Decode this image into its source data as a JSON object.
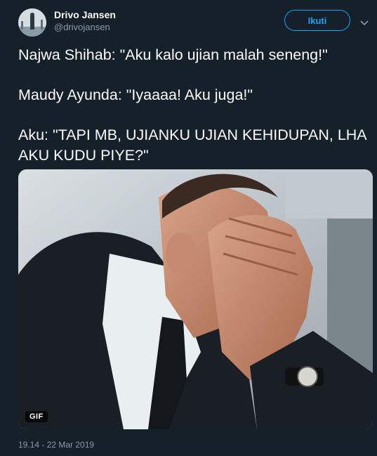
{
  "author": {
    "name": "Drivo Jansen",
    "handle": "@drivojansen"
  },
  "follow_button": {
    "label": "Ikuti"
  },
  "tweet": {
    "lines": [
      "Najwa Shihab: \"Aku kalo ujian malah seneng!\"",
      "Maudy Ayunda: \"Iyaaaa! Aku juga!\"",
      "Aku: \"TAPI MB, UJIANKU UJIAN KEHIDUPAN, LHA AKU KUDU PIYE?\""
    ]
  },
  "media": {
    "badge": "GIF"
  },
  "timestamp": "19.14 - 22 Mar 2019",
  "colors": {
    "background": "#15202b",
    "accent": "#1da1f2",
    "muted": "#8899a6"
  },
  "icons": {
    "menu": "chevron-down-icon"
  }
}
